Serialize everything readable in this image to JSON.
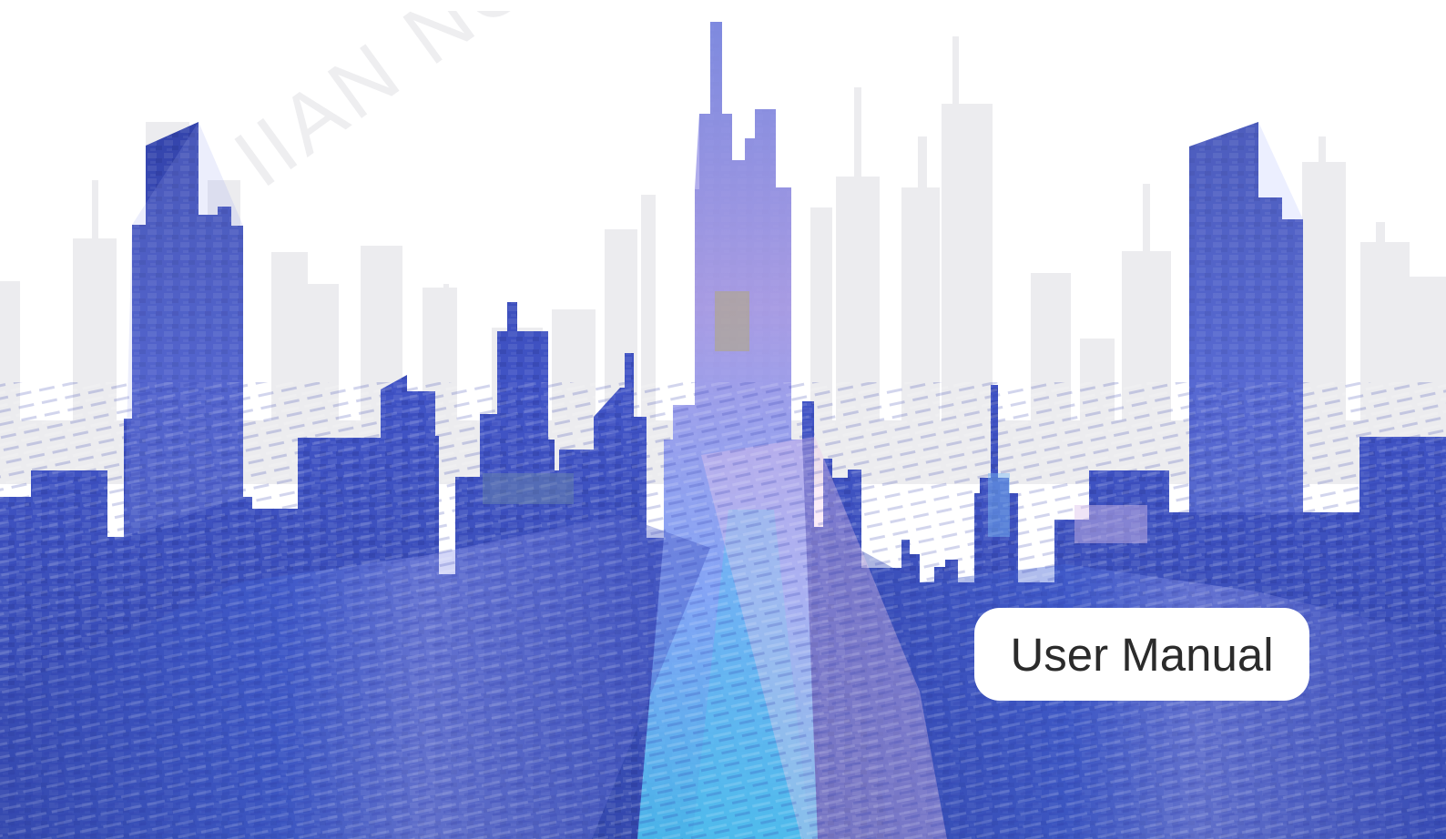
{
  "cover": {
    "title": "User Manual",
    "watermark": "IIAN NO",
    "colors": {
      "background": "#ffffff",
      "skyline_back": "#ececef",
      "skyline_front_dark": "#2f3f9d",
      "skyline_front_mid": "#4c67d8",
      "skyline_front_light": "#d3b7e7",
      "label_text": "#2b2b2b"
    }
  }
}
